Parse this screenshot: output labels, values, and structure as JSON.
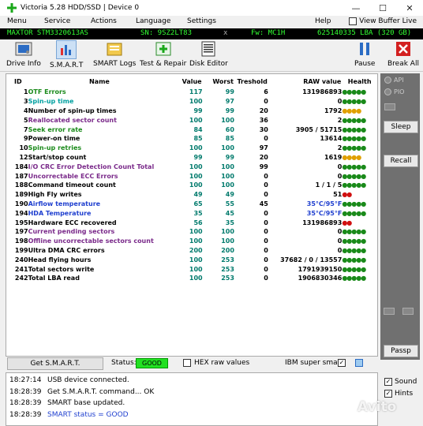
{
  "window": {
    "title": "Victoria 5.28 HDD/SSD | Device 0",
    "minimize": "—",
    "maximize": "☐",
    "close": "✕"
  },
  "menu": {
    "items": [
      "Menu",
      "Service",
      "Actions",
      "Language",
      "Settings",
      "Help"
    ],
    "view_buffer_label": "View Buffer Live"
  },
  "drive": {
    "model": "MAXTOR STM3320613AS",
    "serial": "SN: 9SZ2LT83",
    "x": "x",
    "firmware": "Fw: MC1H",
    "capacity": "625140335 LBA (320 GB)"
  },
  "toolbar": {
    "drive_info": "Drive Info",
    "smart": "S.M.A.R.T",
    "smart_logs": "SMART Logs",
    "test_repair": "Test & Repair",
    "disk_editor": "Disk Editor",
    "pause": "Pause",
    "break_all": "Break All"
  },
  "table": {
    "headers": {
      "id": "ID",
      "name": "Name",
      "value": "Value",
      "worst": "Worst",
      "threshold": "Treshold",
      "raw": "RAW value",
      "health": "Health"
    },
    "rows": [
      {
        "id": "1",
        "name": "OTF Errors",
        "value": "117",
        "worst": "99",
        "thr": "6",
        "raw": "131986893",
        "health": "●●●●●",
        "nc": "green",
        "rc": "black",
        "hc": "green"
      },
      {
        "id": "3",
        "name": "Spin-up time",
        "value": "100",
        "worst": "97",
        "thr": "0",
        "raw": "0",
        "health": "●●●●●",
        "nc": "cyan",
        "rc": "black",
        "hc": "green"
      },
      {
        "id": "4",
        "name": "Number of spin-up times",
        "value": "99",
        "worst": "99",
        "thr": "20",
        "raw": "1792",
        "health": "●●●●",
        "nc": "black",
        "rc": "black",
        "hc": "gold"
      },
      {
        "id": "5",
        "name": "Reallocated sector count",
        "value": "100",
        "worst": "100",
        "thr": "36",
        "raw": "2",
        "health": "●●●●●",
        "nc": "purple",
        "rc": "black",
        "hc": "green"
      },
      {
        "id": "7",
        "name": "Seek error rate",
        "value": "84",
        "worst": "60",
        "thr": "30",
        "raw": "3905 / 51715",
        "health": "●●●●●",
        "nc": "green",
        "rc": "black",
        "hc": "green"
      },
      {
        "id": "9",
        "name": "Power-on time",
        "value": "85",
        "worst": "85",
        "thr": "0",
        "raw": "13614",
        "health": "●●●●●",
        "nc": "black",
        "rc": "black",
        "hc": "green"
      },
      {
        "id": "10",
        "name": "Spin-up retries",
        "value": "100",
        "worst": "100",
        "thr": "97",
        "raw": "2",
        "health": "●●●●●",
        "nc": "green",
        "rc": "black",
        "hc": "green"
      },
      {
        "id": "12",
        "name": "Start/stop count",
        "value": "99",
        "worst": "99",
        "thr": "20",
        "raw": "1619",
        "health": "●●●●",
        "nc": "black",
        "rc": "black",
        "hc": "gold"
      },
      {
        "id": "184",
        "name": "I/O CRC Error Detection Count Total",
        "value": "100",
        "worst": "100",
        "thr": "99",
        "raw": "0",
        "health": "●●●●●",
        "nc": "purple",
        "rc": "black",
        "hc": "green"
      },
      {
        "id": "187",
        "name": "Uncorrectable ECC Errors",
        "value": "100",
        "worst": "100",
        "thr": "0",
        "raw": "0",
        "health": "●●●●●",
        "nc": "purple",
        "rc": "black",
        "hc": "green"
      },
      {
        "id": "188",
        "name": "Command timeout count",
        "value": "100",
        "worst": "100",
        "thr": "0",
        "raw": "1 / 1 / 5",
        "health": "●●●●●",
        "nc": "black",
        "rc": "black",
        "hc": "green"
      },
      {
        "id": "189",
        "name": "High Fly writes",
        "value": "49",
        "worst": "49",
        "thr": "0",
        "raw": "51",
        "health": "●●",
        "nc": "black",
        "rc": "black",
        "hc": "red"
      },
      {
        "id": "190",
        "name": "Airflow temperature",
        "value": "65",
        "worst": "55",
        "thr": "45",
        "raw": "35°C/95°F",
        "health": "●●●●●",
        "nc": "blue",
        "rc": "blue",
        "hc": "green"
      },
      {
        "id": "194",
        "name": "HDA Temperature",
        "value": "35",
        "worst": "45",
        "thr": "0",
        "raw": "35°C/95°F",
        "health": "●●●●●",
        "nc": "blue",
        "rc": "blue",
        "hc": "green"
      },
      {
        "id": "195",
        "name": "Hardware ECC recovered",
        "value": "56",
        "worst": "35",
        "thr": "0",
        "raw": "131986893",
        "health": "●●",
        "nc": "black",
        "rc": "black",
        "hc": "red"
      },
      {
        "id": "197",
        "name": "Current pending sectors",
        "value": "100",
        "worst": "100",
        "thr": "0",
        "raw": "0",
        "health": "●●●●●",
        "nc": "purple",
        "rc": "black",
        "hc": "green"
      },
      {
        "id": "198",
        "name": "Offline uncorrectable sectors count",
        "value": "100",
        "worst": "100",
        "thr": "0",
        "raw": "0",
        "health": "●●●●●",
        "nc": "purple",
        "rc": "black",
        "hc": "green"
      },
      {
        "id": "199",
        "name": "Ultra DMA CRC errors",
        "value": "200",
        "worst": "200",
        "thr": "0",
        "raw": "0",
        "health": "●●●●●",
        "nc": "black",
        "rc": "black",
        "hc": "green"
      },
      {
        "id": "240",
        "name": "Head flying hours",
        "value": "100",
        "worst": "253",
        "thr": "0",
        "raw": "37682 / 0 / 13557",
        "health": "●●●●●",
        "nc": "black",
        "rc": "black",
        "hc": "green"
      },
      {
        "id": "241",
        "name": "Total sectors write",
        "value": "100",
        "worst": "253",
        "thr": "0",
        "raw": "1791939150",
        "health": "●●●●●",
        "nc": "black",
        "rc": "black",
        "hc": "green"
      },
      {
        "id": "242",
        "name": "Total LBA read",
        "value": "100",
        "worst": "253",
        "thr": "0",
        "raw": "1906830346",
        "health": "●●●●●",
        "nc": "black",
        "rc": "black",
        "hc": "green"
      }
    ]
  },
  "right_panel": {
    "api": "API",
    "pio": "PIO",
    "sleep": "Sleep",
    "recall": "Recall",
    "passp": "Passp"
  },
  "status": {
    "get_smart": "Get S.M.A.R.T.",
    "status_label": "Status:",
    "status_value": "GOOD",
    "hex_raw": "HEX raw values",
    "ibm_super_smart": "IBM super smart:",
    "checkmark": "✓"
  },
  "log": [
    {
      "time": "18:27:14",
      "msg": "USB device connected.",
      "blue": false
    },
    {
      "time": "18:28:39",
      "msg": "Get S.M.A.R.T. command... OK",
      "blue": false
    },
    {
      "time": "18:28:39",
      "msg": "SMART base updated.",
      "blue": false
    },
    {
      "time": "18:28:39",
      "msg": "SMART status = GOOD",
      "blue": true
    }
  ],
  "side_options": {
    "sound": "Sound",
    "hints": "Hints",
    "checkmark": "✓"
  },
  "watermark": "Avito",
  "colors": {
    "green": "#1a8a1a",
    "gold": "#e0a000",
    "red": "#d01010",
    "black": "#000000",
    "cyan": "#00a0a0",
    "purple": "#7a2a8a",
    "blue": "#1f3fcf"
  }
}
